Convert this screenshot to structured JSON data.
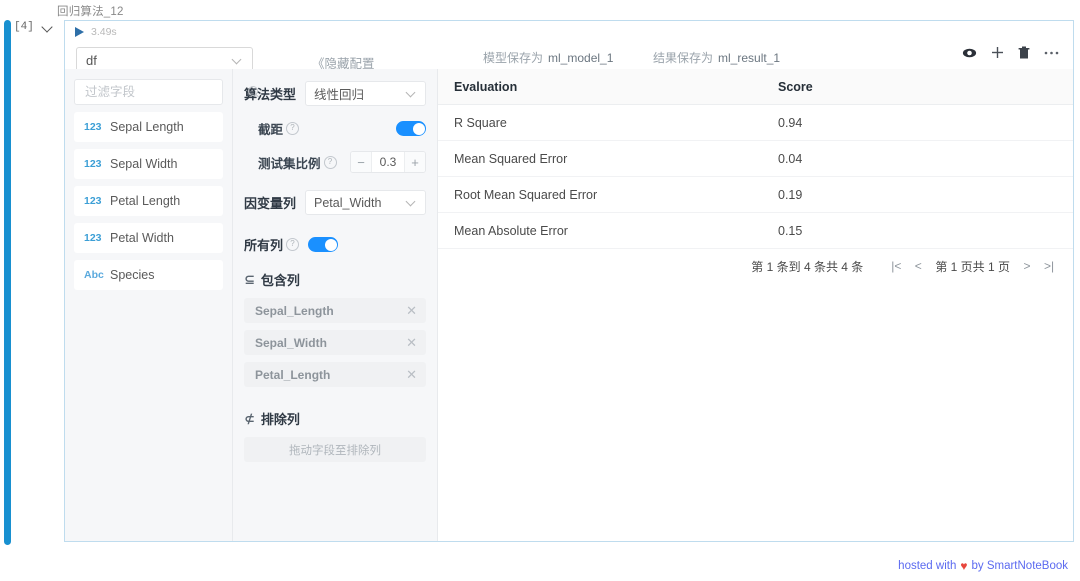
{
  "cell": {
    "title": "回归算法_12",
    "exec_count": "[4]",
    "run_time": "3.49s",
    "collapse_icon": "chevron-down-icon",
    "run_icon": "play-triangle-icon"
  },
  "toolbar": {
    "source_select": {
      "value": "df",
      "chevron": "chevron-down-icon"
    },
    "hide_config_label": "《隐藏配置",
    "model_save_label": "模型保存为",
    "model_save_value": "ml_model_1",
    "result_save_label": "结果保存为",
    "result_save_value": "ml_result_1",
    "icons": [
      {
        "name": "eye-icon",
        "glyph": "eye"
      },
      {
        "name": "plus-icon",
        "glyph": "plus"
      },
      {
        "name": "trash-icon",
        "glyph": "trash"
      },
      {
        "name": "ellipsis-icon",
        "glyph": "ellipsis"
      }
    ]
  },
  "fields_panel": {
    "filter_placeholder": "过滤字段",
    "filter_value": "",
    "search_icon": "search-icon",
    "items": [
      {
        "type": "123",
        "name": "Sepal Length"
      },
      {
        "type": "123",
        "name": "Sepal Width"
      },
      {
        "type": "123",
        "name": "Petal Length"
      },
      {
        "type": "123",
        "name": "Petal Width"
      },
      {
        "type": "Abc",
        "name": "Species"
      }
    ]
  },
  "config_panel": {
    "algorithm_label": "算法类型",
    "algorithm_value": "线性回归",
    "intercept_label": "截距",
    "intercept_on": true,
    "test_ratio_label": "测试集比例",
    "test_ratio_value": "0.3",
    "stepper_minus": "−",
    "stepper_plus": "+",
    "dependent_label": "因变量列",
    "dependent_value": "Petal_Width",
    "all_columns_label": "所有列",
    "all_columns_on": true,
    "include_section": {
      "glyph": "⊆",
      "label": "包含列"
    },
    "include_columns": [
      "Sepal_Length",
      "Sepal_Width",
      "Petal_Length"
    ],
    "exclude_section": {
      "glyph": "⊄",
      "label": "排除列"
    },
    "exclude_placeholder": "拖动字段至排除列",
    "help_mark": "?"
  },
  "result_table": {
    "columns": [
      "Evaluation",
      "Score"
    ],
    "rows": [
      {
        "evaluation": "R Square",
        "score": "0.94"
      },
      {
        "evaluation": "Mean Squared Error",
        "score": "0.04"
      },
      {
        "evaluation": "Root Mean Squared Error",
        "score": "0.19"
      },
      {
        "evaluation": "Mean Absolute Error",
        "score": "0.15"
      }
    ],
    "pagination": {
      "total_text": "第 1 条到 4 条共 4 条",
      "first": "|<",
      "prev": "<",
      "page_text": "第 1 页共 1 页",
      "next": ">",
      "last": ">|"
    }
  },
  "footer": {
    "prefix": "hosted with",
    "heart": "♥",
    "suffix": "by SmartNoteBook"
  },
  "colors": {
    "accent_blue": "#1890d0",
    "toggle_blue": "#1a90ff",
    "type_badge": "#3c9fd6",
    "footer_link": "#5b6af0",
    "heart_red": "#e8463c"
  }
}
